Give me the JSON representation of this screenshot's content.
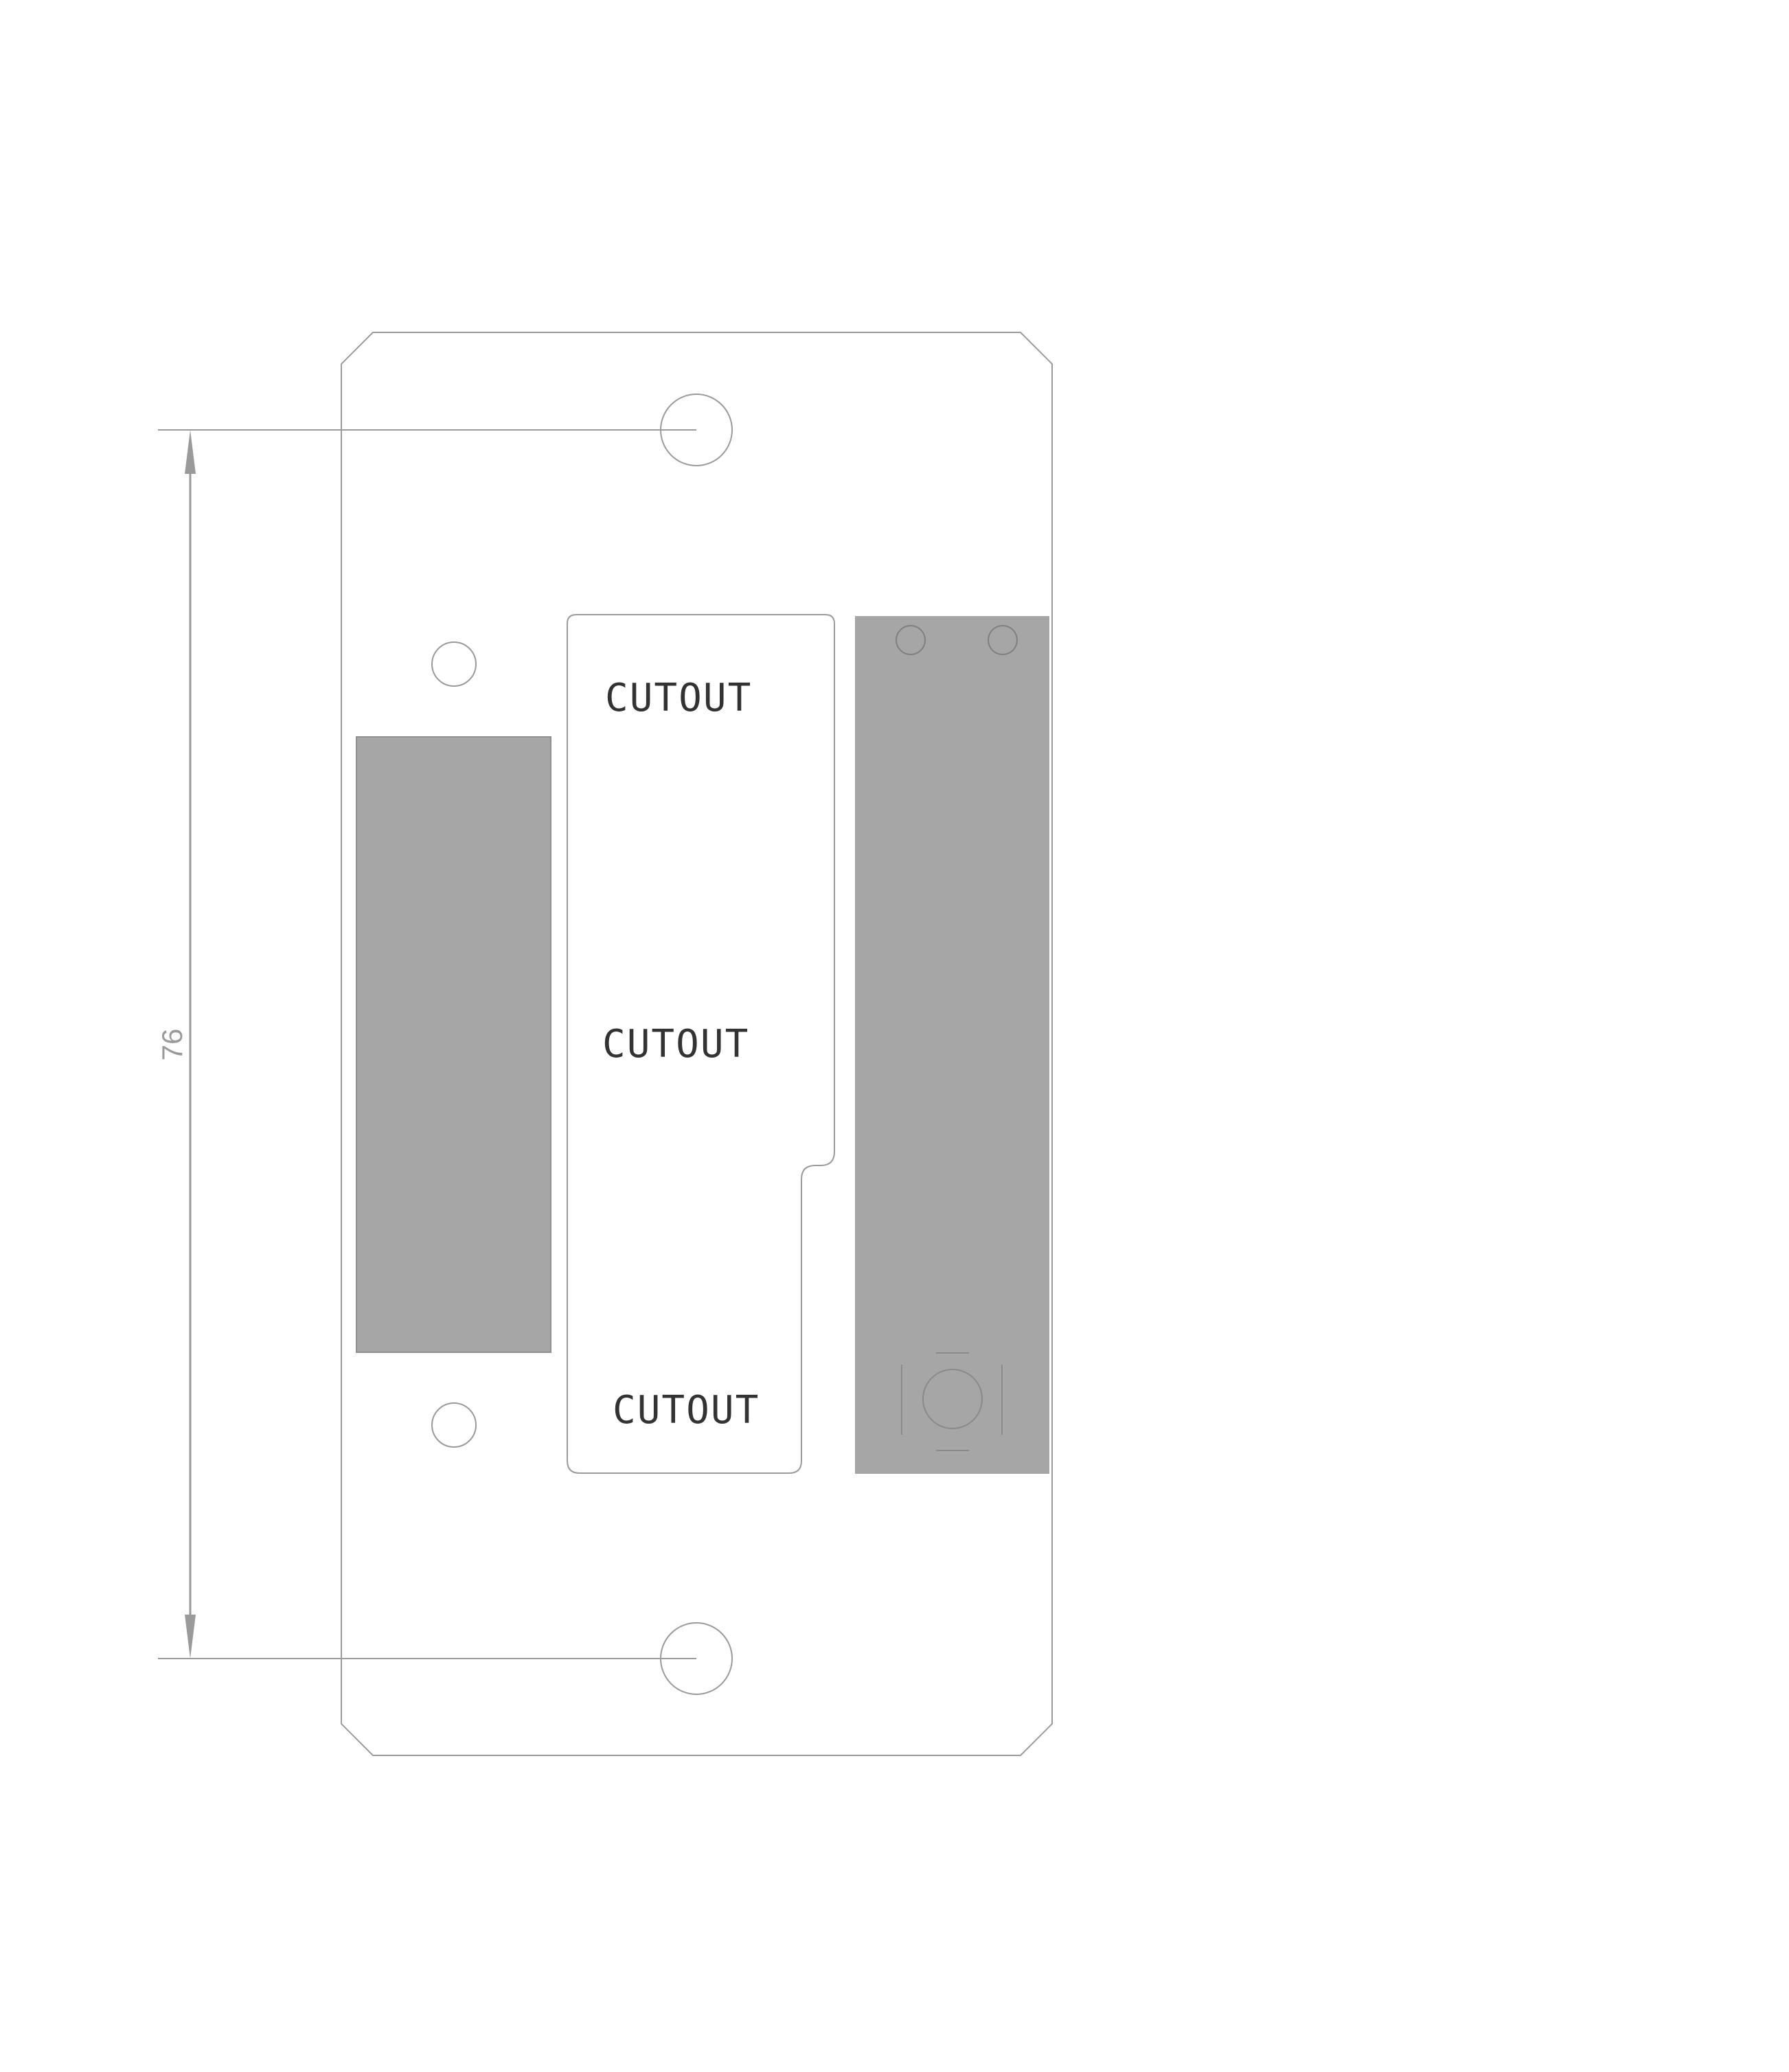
{
  "drawing": {
    "dimension": {
      "value": "76"
    },
    "cutout_labels": [
      "CUTOUT",
      "CUTOUT",
      "CUTOUT"
    ]
  },
  "colors": {
    "outline": "#9a9a9a",
    "fill": "#a6a6a6",
    "text": "#333333",
    "dimension": "#9a9a9a",
    "symbol": "#8a8a8a"
  }
}
